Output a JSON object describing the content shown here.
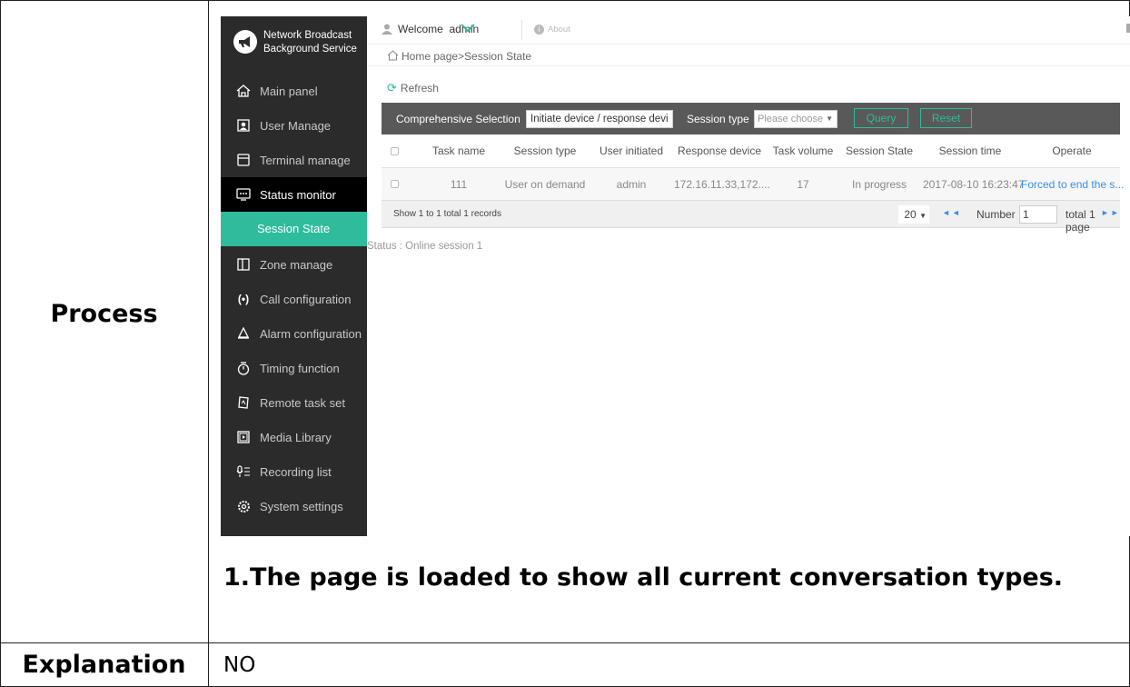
{
  "doc": {
    "process_label": "Process",
    "explanation_label": "Explanation",
    "explanation_value": "NO",
    "caption": "1.The page is loaded to show all current conversation types."
  },
  "app": {
    "brand_line1": "Network Broadcast",
    "brand_line2": "Background Service",
    "welcome": "Welcome",
    "user": "admin",
    "about": "About",
    "breadcrumb": "Home page>Session State",
    "refresh": "Refresh",
    "status_line": "Status : Online session 1",
    "accent_color": "#2ebc9c",
    "link_color": "#3a8ee6"
  },
  "sidebar": {
    "items": [
      {
        "label": "Main panel",
        "icon": "home-icon"
      },
      {
        "label": "User Manage",
        "icon": "user-manage-icon"
      },
      {
        "label": "Terminal manage",
        "icon": "terminal-icon"
      },
      {
        "label": "Status monitor",
        "icon": "monitor-icon"
      },
      {
        "label": "Session State",
        "icon": ""
      },
      {
        "label": "Zone manage",
        "icon": "zone-icon"
      },
      {
        "label": "Call configuration",
        "icon": "call-icon"
      },
      {
        "label": "Alarm configuration",
        "icon": "alarm-icon"
      },
      {
        "label": "Timing function",
        "icon": "timer-icon"
      },
      {
        "label": "Remote task set",
        "icon": "remote-task-icon"
      },
      {
        "label": "Media Library",
        "icon": "media-icon"
      },
      {
        "label": "Recording list",
        "icon": "recording-icon"
      },
      {
        "label": "System settings",
        "icon": "settings-icon"
      }
    ]
  },
  "filter": {
    "label": "Comprehensive Selection",
    "input_value": "Initiate device / response devi",
    "session_type_label": "Session type",
    "session_type_placeholder": "Please choose",
    "query": "Query",
    "reset": "Reset"
  },
  "table": {
    "columns": [
      "Task name",
      "Session type",
      "User initiated",
      "Response device",
      "Task volume",
      "Session State",
      "Session time",
      "Operate"
    ],
    "rows": [
      [
        "111",
        "User on demand",
        "admin",
        "172.16.11.33,172....",
        "17",
        "In progress",
        "2017-08-10 16:23:47",
        "Forced to end the s..."
      ]
    ]
  },
  "pager": {
    "info": "Show 1 to 1 total 1 records",
    "page_size": "20",
    "number_label": "Number",
    "number_value": "1",
    "total": "total 1 page"
  }
}
